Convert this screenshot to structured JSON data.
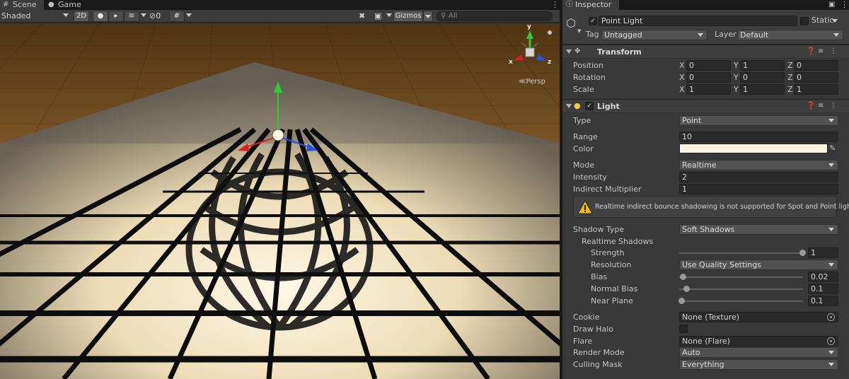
{
  "scene_tabs": {
    "scene": "Scene",
    "game": "Game"
  },
  "scene_toolbar": {
    "draw_mode": "Shaded",
    "mode_2d": "2D",
    "hidden_count": "0",
    "gizmos": "Gizmos",
    "search_placeholder": "All"
  },
  "viewport": {
    "projection": "Persp",
    "axis_x": "x",
    "axis_z": "z",
    "axis_y": "y"
  },
  "inspector": {
    "tab_title": "Inspector",
    "object_name": "Point Light",
    "static_label": "Static",
    "tag_label": "Tag",
    "tag_value": "Untagged",
    "layer_label": "Layer",
    "layer_value": "Default",
    "transform": {
      "title": "Transform",
      "rows": [
        {
          "label": "Position",
          "x": "0",
          "y": "1",
          "z": "0"
        },
        {
          "label": "Rotation",
          "x": "0",
          "y": "0",
          "z": "0"
        },
        {
          "label": "Scale",
          "x": "1",
          "y": "1",
          "z": "1"
        }
      ],
      "axis_x": "X",
      "axis_y": "Y",
      "axis_z": "Z"
    },
    "light": {
      "title": "Light",
      "type_label": "Type",
      "type_value": "Point",
      "range_label": "Range",
      "range_value": "10",
      "color_label": "Color",
      "color_value": "#fdf3e2",
      "mode_label": "Mode",
      "mode_value": "Realtime",
      "intensity_label": "Intensity",
      "intensity_value": "2",
      "indirect_label": "Indirect Multiplier",
      "indirect_value": "1",
      "warning": "Realtime indirect bounce shadowing is not supported for Spot and Point lights.",
      "shadow_type_label": "Shadow Type",
      "shadow_type_value": "Soft Shadows",
      "realtime_shadows_label": "Realtime Shadows",
      "strength_label": "Strength",
      "strength_value": "1",
      "resolution_label": "Resolution",
      "resolution_value": "Use Quality Settings",
      "bias_label": "Bias",
      "bias_value": "0.02",
      "normal_bias_label": "Normal Bias",
      "normal_bias_value": "0.1",
      "near_plane_label": "Near Plane",
      "near_plane_value": "0.1",
      "cookie_label": "Cookie",
      "cookie_value": "None (Texture)",
      "draw_halo_label": "Draw Halo",
      "flare_label": "Flare",
      "flare_value": "None (Flare)",
      "render_mode_label": "Render Mode",
      "render_mode_value": "Auto",
      "culling_mask_label": "Culling Mask",
      "culling_mask_value": "Everything"
    }
  },
  "colors": {
    "sky": "#6b4a1e",
    "floor": "#fbefcf",
    "gizmo_x": "#d42222",
    "gizmo_y": "#35c43a",
    "gizmo_z": "#2a50e0",
    "warning": "#f2b51b"
  }
}
